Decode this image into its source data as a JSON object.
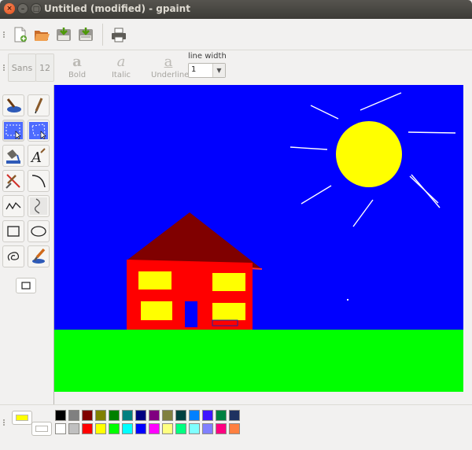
{
  "window": {
    "title": "Untitled (modified) - gpaint",
    "close_glyph": "×",
    "min_glyph": "–",
    "max_glyph": "□"
  },
  "toolbar": {
    "buttons": [
      {
        "name": "new-button",
        "icon": "new-document-icon"
      },
      {
        "name": "open-button",
        "icon": "open-folder-icon"
      },
      {
        "name": "save-button",
        "icon": "save-icon"
      },
      {
        "name": "save-as-button",
        "icon": "save-as-icon"
      },
      {
        "name": "print-button",
        "icon": "printer-icon"
      }
    ]
  },
  "font_bar": {
    "font_name": "Sans",
    "font_size": "12",
    "bold_glyph": "a",
    "bold_label": "Bold",
    "italic_glyph": "a",
    "italic_label": "Italic",
    "underline_glyph": "a",
    "underline_label": "Underline",
    "line_width_label": "line width",
    "line_width_value": "1",
    "dropdown_glyph": "▼"
  },
  "tools": [
    "paint-bucket-fill-tool",
    "pen-tool",
    "rectangle-select-tool",
    "freehand-select-tool",
    "fill-tool",
    "text-tool",
    "erase-tool",
    "curve-tool",
    "freehand-line-tool",
    "multiline-tool",
    "rectangle-tool",
    "oval-tool",
    "lasso-shape-tool",
    "paintbrush-tool"
  ],
  "palette": {
    "foreground_color": "#ffff00",
    "background_color": "#ffffff",
    "colors": [
      "#000000",
      "#808080",
      "#800000",
      "#808000",
      "#008000",
      "#008080",
      "#000080",
      "#800080",
      "#808040",
      "#004040",
      "#0080ff",
      "#3f14ff",
      "#008040",
      "#1e3260",
      "#ffffff",
      "#c0c0c0",
      "#ff0000",
      "#ffff00",
      "#00ff00",
      "#00ffff",
      "#0000ff",
      "#ff00ff",
      "#ffff80",
      "#00ff80",
      "#80ffff",
      "#8080ff",
      "#ff0080",
      "#ff8040"
    ]
  },
  "drawing": {
    "sky_color": "#0000ff",
    "grass_color": "#00ff00",
    "sun_color": "#ffff00",
    "house_color": "#ff0000",
    "roof_color": "#800000",
    "window_color": "#ffff00",
    "door_color": "#0000ff"
  }
}
